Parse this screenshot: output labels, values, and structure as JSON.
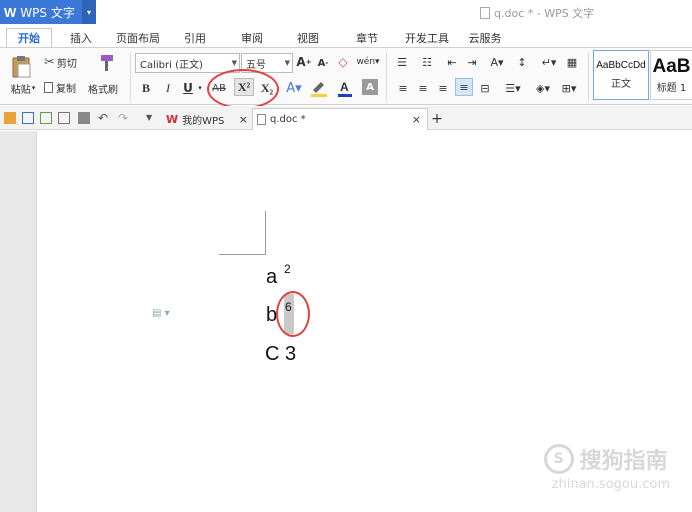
{
  "titlebar": {
    "app_logo": "W",
    "app_name": "WPS 文字",
    "window_title": "q.doc * - WPS 文字"
  },
  "tabs": [
    "开始",
    "插入",
    "页面布局",
    "引用",
    "审阅",
    "视图",
    "章节",
    "开发工具",
    "云服务"
  ],
  "ribbon": {
    "paste": "粘贴",
    "cut": "剪切",
    "copy": "复制",
    "format_painter": "格式刷",
    "font_name": "Calibri (正文)",
    "font_size": "五号",
    "bold": "B",
    "italic": "I",
    "underline": "U",
    "strikethrough": "AB",
    "superscript": "X²",
    "subscript": "X₂",
    "style_normal_preview": "AaBbCcDd",
    "style_normal": "正文",
    "style_heading_preview": "AaB",
    "style_heading": "标题 1"
  },
  "quickbar": {
    "doc_tabs": [
      {
        "label": "我的WPS"
      },
      {
        "label": "q.doc *"
      }
    ],
    "new_tab": "+",
    "close": "×"
  },
  "document": {
    "lines": [
      {
        "text": "a",
        "sup": "2"
      },
      {
        "text": "b",
        "sup": "6"
      },
      {
        "text": "C 3",
        "sup": ""
      }
    ]
  },
  "watermark": {
    "title": "搜狗指南",
    "url": "zhinan.sogou.com"
  },
  "colors": {
    "app_button": "#3c78d8",
    "active_tab": "#2e6bd1",
    "annotation_circle": "#e04040",
    "font_color_bar": "#1f3fbf",
    "highlight_bar": "#f5d142"
  }
}
